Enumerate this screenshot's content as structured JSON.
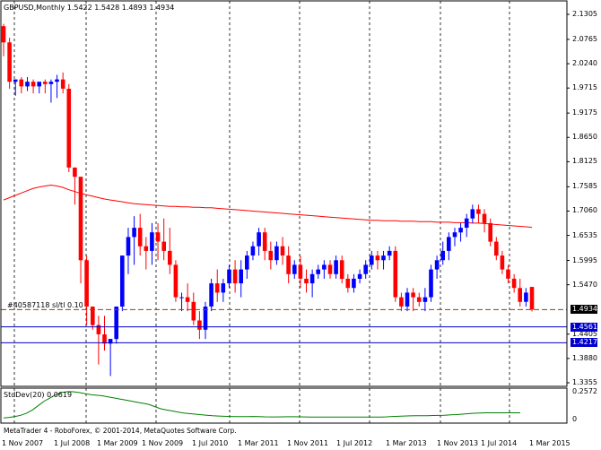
{
  "chart_header": {
    "ohlc_text": "GBPUSD,Monthly  1.5422 1.5428 1.4893 1.4934"
  },
  "order_line": {
    "label": "#40587118 sl/tl 0.10",
    "price": 1.4934
  },
  "current_price_badge": {
    "text": "1.4934",
    "bg": "#000000",
    "fg": "#ffffff"
  },
  "level_badges": [
    {
      "text": "1.4561",
      "price": 1.4561,
      "bg": "#0000cc",
      "fg": "#ffffff"
    },
    {
      "text": "1.4217",
      "price": 1.4217,
      "bg": "#0000cc",
      "fg": "#ffffff"
    }
  ],
  "price_axis": {
    "ticks": [
      "2.1305",
      "2.0765",
      "2.0240",
      "1.9715",
      "1.9175",
      "1.8650",
      "1.8125",
      "1.7585",
      "1.7060",
      "1.6535",
      "1.5995",
      "1.5470",
      "1.4405",
      "1.3880",
      "1.3355"
    ]
  },
  "indicator": {
    "label": "StdDev(20) 0.0619",
    "ticks": [
      "0.2572",
      "0"
    ],
    "values": [
      0.015,
      0.02,
      0.028,
      0.04,
      0.06,
      0.09,
      0.13,
      0.17,
      0.2,
      0.23,
      0.25,
      0.258,
      0.257,
      0.25,
      0.24,
      0.23,
      0.225,
      0.22,
      0.21,
      0.2,
      0.19,
      0.18,
      0.17,
      0.16,
      0.15,
      0.14,
      0.12,
      0.1,
      0.09,
      0.08,
      0.07,
      0.06,
      0.055,
      0.05,
      0.045,
      0.04,
      0.035,
      0.032,
      0.03,
      0.028,
      0.027,
      0.027,
      0.027,
      0.028,
      0.027,
      0.025,
      0.024,
      0.024,
      0.025,
      0.026,
      0.026,
      0.025,
      0.024,
      0.023,
      0.022,
      0.022,
      0.022,
      0.022,
      0.022,
      0.022,
      0.022,
      0.022,
      0.022,
      0.022,
      0.022,
      0.023,
      0.025,
      0.028,
      0.03,
      0.032,
      0.034,
      0.035,
      0.036,
      0.036,
      0.037,
      0.038,
      0.04,
      0.043,
      0.046,
      0.05,
      0.054,
      0.058,
      0.06,
      0.062,
      0.0619,
      0.0619,
      0.0619,
      0.0619,
      0.0619,
      0.0619
    ]
  },
  "footer_text": "MetaTrader 4 - RoboForex, © 2001-2014, MetaQuotes Software Corp.",
  "time_axis": {
    "labels": [
      "1 Nov 2007",
      "1 Jul 2008",
      "1 Mar 2009",
      "1 Nov 2009",
      "1 Jul 2010",
      "1 Mar 2011",
      "1 Nov 2011",
      "1 Jul 2012",
      "1 Mar 2013",
      "1 Nov 2013",
      "1 Jul 2014",
      "1 Mar 2015"
    ]
  },
  "colors": {
    "bull": "#0000ff",
    "bear": "#ff0000",
    "moving_average": "#ff0000",
    "stddev_line": "#008000",
    "grid": "#000000",
    "order_line": "#8b4513",
    "support_line": "#0000cc"
  },
  "chart_data": {
    "type": "candlestick",
    "symbol": "GBPUSD",
    "timeframe": "Monthly",
    "ylim": [
      1.3355,
      2.1305
    ],
    "candles": [
      [
        2.105,
        2.11,
        2.04,
        2.07
      ],
      [
        2.07,
        2.08,
        1.97,
        1.985
      ],
      [
        1.985,
        1.99,
        1.955,
        1.99
      ],
      [
        1.99,
        1.995,
        1.96,
        1.975
      ],
      [
        1.975,
        1.995,
        1.965,
        1.985
      ],
      [
        1.985,
        1.99,
        1.96,
        1.975
      ],
      [
        1.975,
        1.98,
        1.96,
        1.985
      ],
      [
        1.985,
        1.99,
        1.96,
        1.98
      ],
      [
        1.98,
        1.99,
        1.94,
        1.985
      ],
      [
        1.985,
        2.0,
        1.95,
        1.99
      ],
      [
        1.99,
        2.005,
        1.96,
        1.97
      ],
      [
        1.97,
        1.98,
        1.79,
        1.8
      ],
      [
        1.8,
        1.8,
        1.72,
        1.78
      ],
      [
        1.78,
        1.78,
        1.55,
        1.6
      ],
      [
        1.6,
        1.61,
        1.46,
        1.5
      ],
      [
        1.5,
        1.5,
        1.45,
        1.46
      ],
      [
        1.46,
        1.48,
        1.375,
        1.44
      ],
      [
        1.44,
        1.48,
        1.405,
        1.42
      ],
      [
        1.42,
        1.43,
        1.35,
        1.43
      ],
      [
        1.43,
        1.5,
        1.42,
        1.5
      ],
      [
        1.5,
        1.61,
        1.49,
        1.61
      ],
      [
        1.61,
        1.67,
        1.57,
        1.65
      ],
      [
        1.65,
        1.695,
        1.59,
        1.67
      ],
      [
        1.67,
        1.7,
        1.61,
        1.63
      ],
      [
        1.63,
        1.65,
        1.58,
        1.62
      ],
      [
        1.62,
        1.68,
        1.59,
        1.66
      ],
      [
        1.66,
        1.68,
        1.6,
        1.64
      ],
      [
        1.64,
        1.69,
        1.6,
        1.62
      ],
      [
        1.62,
        1.67,
        1.57,
        1.59
      ],
      [
        1.59,
        1.6,
        1.51,
        1.52
      ],
      [
        1.52,
        1.53,
        1.49,
        1.52
      ],
      [
        1.52,
        1.55,
        1.49,
        1.51
      ],
      [
        1.51,
        1.53,
        1.46,
        1.47
      ],
      [
        1.47,
        1.49,
        1.43,
        1.45
      ],
      [
        1.45,
        1.51,
        1.43,
        1.5
      ],
      [
        1.5,
        1.56,
        1.49,
        1.55
      ],
      [
        1.55,
        1.58,
        1.51,
        1.53
      ],
      [
        1.53,
        1.56,
        1.51,
        1.55
      ],
      [
        1.55,
        1.59,
        1.54,
        1.58
      ],
      [
        1.58,
        1.6,
        1.53,
        1.55
      ],
      [
        1.55,
        1.6,
        1.52,
        1.58
      ],
      [
        1.58,
        1.62,
        1.56,
        1.61
      ],
      [
        1.61,
        1.64,
        1.6,
        1.63
      ],
      [
        1.63,
        1.67,
        1.61,
        1.66
      ],
      [
        1.66,
        1.67,
        1.6,
        1.62
      ],
      [
        1.62,
        1.64,
        1.58,
        1.6
      ],
      [
        1.6,
        1.64,
        1.59,
        1.63
      ],
      [
        1.63,
        1.65,
        1.59,
        1.61
      ],
      [
        1.61,
        1.63,
        1.55,
        1.57
      ],
      [
        1.57,
        1.6,
        1.56,
        1.59
      ],
      [
        1.59,
        1.61,
        1.54,
        1.56
      ],
      [
        1.56,
        1.58,
        1.53,
        1.55
      ],
      [
        1.55,
        1.58,
        1.52,
        1.57
      ],
      [
        1.57,
        1.59,
        1.56,
        1.58
      ],
      [
        1.58,
        1.6,
        1.56,
        1.59
      ],
      [
        1.59,
        1.6,
        1.56,
        1.57
      ],
      [
        1.57,
        1.61,
        1.56,
        1.6
      ],
      [
        1.6,
        1.61,
        1.55,
        1.56
      ],
      [
        1.56,
        1.57,
        1.53,
        1.54
      ],
      [
        1.54,
        1.57,
        1.53,
        1.56
      ],
      [
        1.56,
        1.58,
        1.55,
        1.57
      ],
      [
        1.57,
        1.6,
        1.56,
        1.59
      ],
      [
        1.59,
        1.62,
        1.58,
        1.61
      ],
      [
        1.61,
        1.62,
        1.58,
        1.6
      ],
      [
        1.6,
        1.62,
        1.58,
        1.61
      ],
      [
        1.61,
        1.63,
        1.6,
        1.62
      ],
      [
        1.62,
        1.63,
        1.51,
        1.52
      ],
      [
        1.52,
        1.53,
        1.49,
        1.5
      ],
      [
        1.5,
        1.54,
        1.49,
        1.53
      ],
      [
        1.53,
        1.54,
        1.49,
        1.52
      ],
      [
        1.52,
        1.53,
        1.5,
        1.51
      ],
      [
        1.51,
        1.54,
        1.49,
        1.52
      ],
      [
        1.52,
        1.59,
        1.51,
        1.58
      ],
      [
        1.58,
        1.61,
        1.56,
        1.6
      ],
      [
        1.6,
        1.64,
        1.59,
        1.62
      ],
      [
        1.62,
        1.66,
        1.6,
        1.65
      ],
      [
        1.65,
        1.67,
        1.63,
        1.66
      ],
      [
        1.66,
        1.68,
        1.64,
        1.67
      ],
      [
        1.67,
        1.7,
        1.65,
        1.69
      ],
      [
        1.69,
        1.72,
        1.68,
        1.71
      ],
      [
        1.71,
        1.72,
        1.68,
        1.7
      ],
      [
        1.7,
        1.71,
        1.66,
        1.68
      ],
      [
        1.68,
        1.69,
        1.63,
        1.64
      ],
      [
        1.64,
        1.65,
        1.6,
        1.61
      ],
      [
        1.61,
        1.62,
        1.57,
        1.58
      ],
      [
        1.58,
        1.59,
        1.55,
        1.56
      ],
      [
        1.56,
        1.57,
        1.53,
        1.54
      ],
      [
        1.54,
        1.56,
        1.5,
        1.51
      ],
      [
        1.51,
        1.54,
        1.5,
        1.53
      ],
      [
        1.5422,
        1.5428,
        1.4893,
        1.4934
      ]
    ],
    "moving_average": [
      1.73,
      1.735,
      1.74,
      1.745,
      1.75,
      1.755,
      1.758,
      1.76,
      1.762,
      1.76,
      1.757,
      1.752,
      1.748,
      1.744,
      1.741,
      1.738,
      1.735,
      1.732,
      1.73,
      1.728,
      1.726,
      1.724,
      1.722,
      1.721,
      1.72,
      1.719,
      1.718,
      1.717,
      1.716,
      1.716,
      1.715,
      1.715,
      1.714,
      1.714,
      1.713,
      1.713,
      1.712,
      1.711,
      1.71,
      1.709,
      1.708,
      1.707,
      1.706,
      1.705,
      1.704,
      1.703,
      1.702,
      1.701,
      1.7,
      1.699,
      1.698,
      1.697,
      1.696,
      1.695,
      1.694,
      1.693,
      1.692,
      1.691,
      1.69,
      1.689,
      1.688,
      1.687,
      1.686,
      1.686,
      1.685,
      1.685,
      1.685,
      1.684,
      1.684,
      1.684,
      1.683,
      1.683,
      1.683,
      1.682,
      1.682,
      1.682,
      1.681,
      1.681,
      1.681,
      1.68,
      1.68,
      1.679,
      1.678,
      1.677,
      1.676,
      1.675,
      1.674,
      1.673,
      1.672,
      1.671
    ],
    "horizontal_levels": [
      1.4934,
      1.4561,
      1.4217
    ],
    "x_labels": [
      "1 Nov 2007",
      "1 Jul 2008",
      "1 Mar 2009",
      "1 Nov 2009",
      "1 Jul 2010",
      "1 Mar 2011",
      "1 Nov 2011",
      "1 Jul 2012",
      "1 Mar 2013",
      "1 Nov 2013",
      "1 Jul 2014",
      "1 Mar 2015"
    ]
  }
}
